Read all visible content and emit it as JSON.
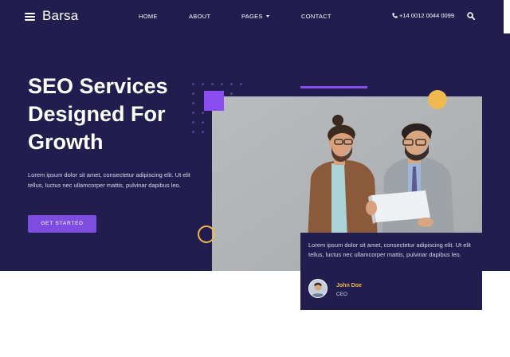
{
  "header": {
    "logo_text": "Barsa",
    "menu": [
      "HOME",
      "ABOUT",
      "PAGES",
      "CONTACT"
    ],
    "phone": "+14 0012 0044 0099",
    "icons": [
      "menu-icon",
      "phone-icon",
      "search-icon",
      "chevron-down-icon"
    ]
  },
  "hero": {
    "headline": "SEO Services Designed For Growth",
    "description": "Lorem ipsum dolor sit amet, consectetur adipiscing elit. Ut elit tellus, luctus nec ullamcorper mattis, pulvinar dapibus leo.",
    "cta_label": "GET STARTED"
  },
  "testimonial": {
    "quote": "Lorem ipsum dolor sit amet, consectetur adipiscing elit. Ut elit tellus, luctus nec ullamcorper mattis, pulvinar dapibus leo.",
    "author": "John Doe",
    "role": "CEO"
  },
  "colors": {
    "navy": "#211d4e",
    "purple": "#7f4ce0",
    "accent_purple": "#8a4ef0",
    "yellow": "#efb94f"
  }
}
